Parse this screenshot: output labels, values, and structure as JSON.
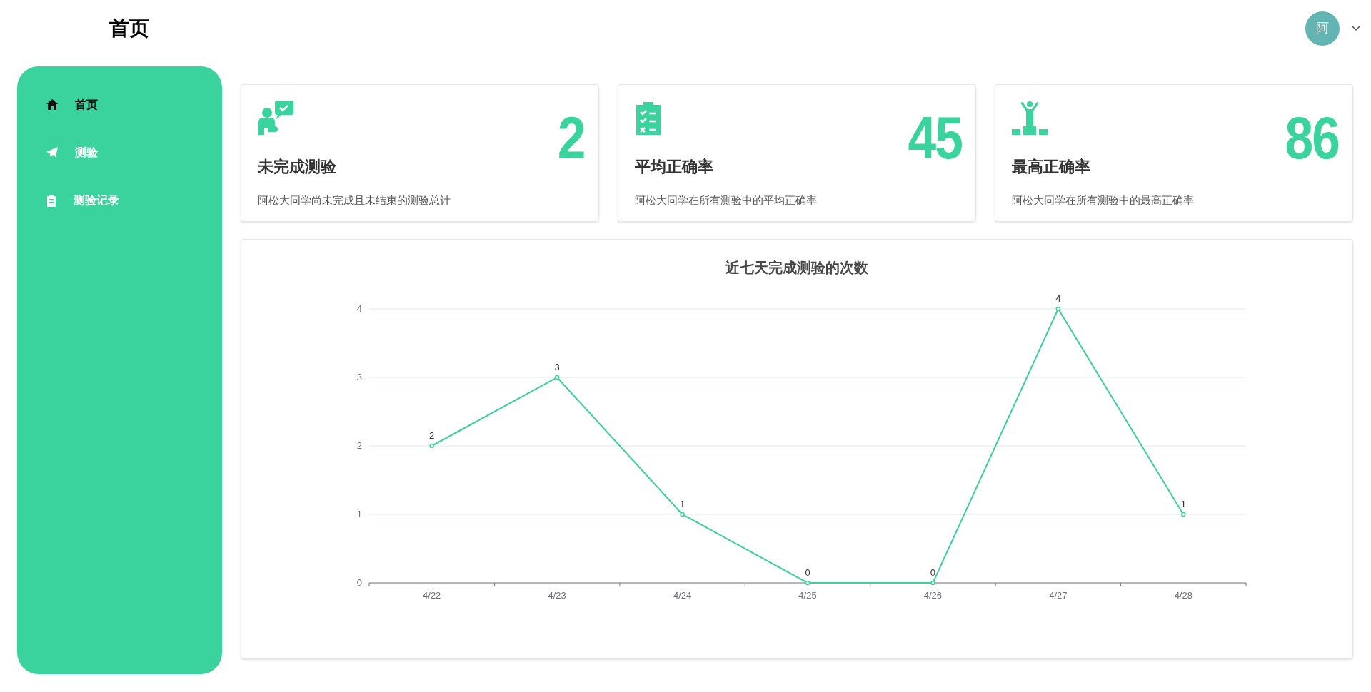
{
  "header": {
    "title": "首页",
    "avatar": "阿"
  },
  "sidebar": {
    "items": [
      {
        "label": "首页",
        "selected": true
      },
      {
        "label": "测验",
        "selected": false
      },
      {
        "label": "测验记录",
        "selected": false
      }
    ]
  },
  "cards": [
    {
      "title": "未完成测验",
      "value": "2",
      "description": "阿松大同学尚未完成且未结束的测验总计"
    },
    {
      "title": "平均正确率",
      "value": "45",
      "description": "阿松大同学在所有测验中的平均正确率"
    },
    {
      "title": "最高正确率",
      "value": "86",
      "description": "阿松大同学在所有测验中的最高正确率"
    }
  ],
  "chart": {
    "chart_data": {
      "type": "line",
      "title": "近七天完成测验的次数",
      "categories": [
        "4/22",
        "4/23",
        "4/24",
        "4/25",
        "4/26",
        "4/27",
        "4/28"
      ],
      "series": [
        {
          "color": "#3ccf9b",
          "marker": true,
          "values": [
            2,
            3,
            1,
            0,
            0,
            4,
            1
          ]
        }
      ],
      "ylim": [
        0,
        4
      ],
      "yticks": [
        0,
        1,
        2,
        3,
        4
      ],
      "grid": true,
      "data_labels": true
    }
  }
}
